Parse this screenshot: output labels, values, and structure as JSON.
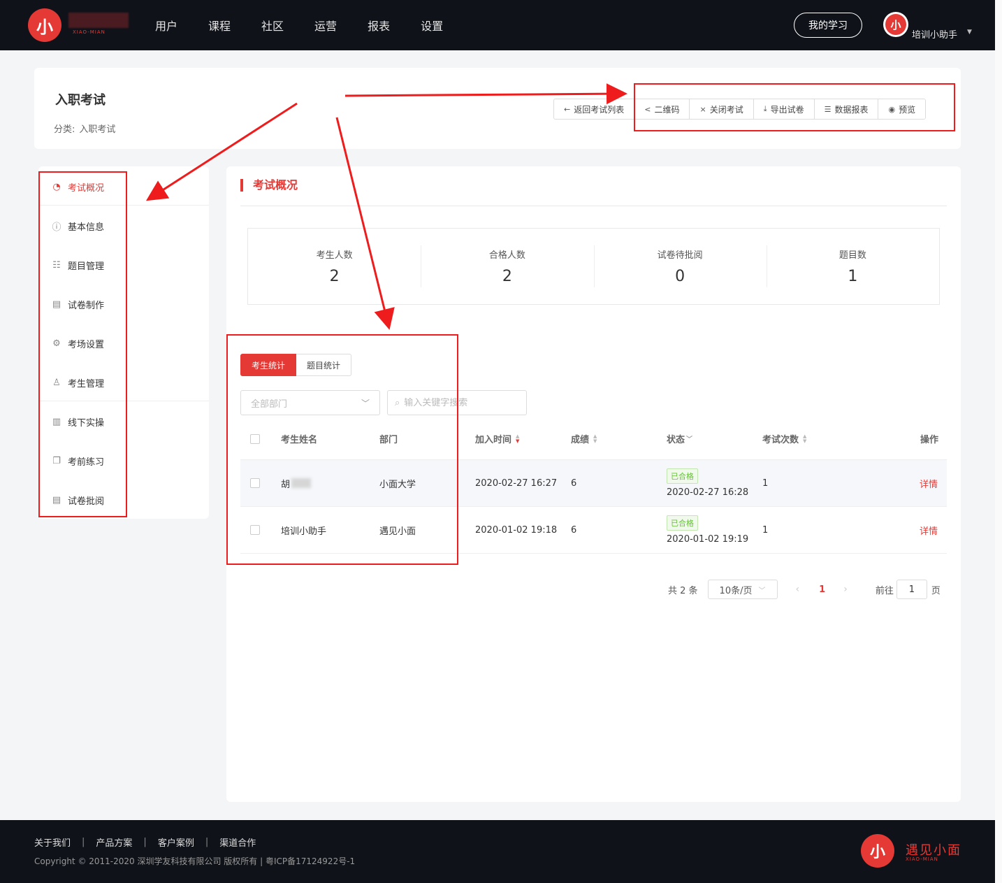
{
  "topbar": {
    "logo_char": "小",
    "logo_sub": "XIAO-MIAN",
    "nav": [
      "用户",
      "课程",
      "社区",
      "运营",
      "报表",
      "设置"
    ],
    "my_study": "我的学习",
    "avatar_char": "小",
    "user_name": "培训小助手"
  },
  "header": {
    "title": "入职考试",
    "category_label": "分类:",
    "category_value": "入职考试",
    "actions": [
      {
        "label": "返回考试列表",
        "icon": "arrow-left-icon",
        "glyph": "←"
      },
      {
        "label": "二维码",
        "icon": "share-icon",
        "glyph": "<"
      },
      {
        "label": "关闭考试",
        "icon": "close-icon",
        "glyph": "×"
      },
      {
        "label": "导出试卷",
        "icon": "download-icon",
        "glyph": "⤓"
      },
      {
        "label": "数据报表",
        "icon": "report-icon",
        "glyph": "☰"
      },
      {
        "label": "预览",
        "icon": "eye-icon",
        "glyph": "◉"
      }
    ]
  },
  "sidebar": {
    "items": [
      {
        "label": "考试概况",
        "icon": "pie-chart-icon",
        "glyph": "◔",
        "active": true
      },
      {
        "label": "基本信息",
        "icon": "info-icon",
        "glyph": "ⓘ"
      },
      {
        "label": "题目管理",
        "icon": "list-icon",
        "glyph": "☷"
      },
      {
        "label": "试卷制作",
        "icon": "paper-edit-icon",
        "glyph": "▤"
      },
      {
        "label": "考场设置",
        "icon": "gear-icon",
        "glyph": "⚙"
      },
      {
        "label": "考生管理",
        "icon": "user-icon",
        "glyph": "♙"
      },
      {
        "label": "线下实操",
        "icon": "sliders-icon",
        "glyph": "▥"
      },
      {
        "label": "考前练习",
        "icon": "copy-icon",
        "glyph": "❐"
      },
      {
        "label": "试卷批阅",
        "icon": "review-icon",
        "glyph": "▤"
      }
    ]
  },
  "main": {
    "section_title": "考试概况",
    "stats": [
      {
        "label": "考生人数",
        "value": "2"
      },
      {
        "label": "合格人数",
        "value": "2"
      },
      {
        "label": "试卷待批阅",
        "value": "0"
      },
      {
        "label": "题目数",
        "value": "1"
      }
    ],
    "tabs": [
      "考生统计",
      "题目统计"
    ],
    "dept_select": "全部部门",
    "search_placeholder": "输入关键字搜索",
    "table": {
      "headers": [
        "考生姓名",
        "部门",
        "加入时间",
        "成绩",
        "状态",
        "考试次数",
        "操作"
      ],
      "rows": [
        {
          "name": "胡",
          "dept": "小面大学",
          "join_time": "2020-02-27 16:27",
          "score": "6",
          "status": "已合格",
          "status_time": "2020-02-27 16:28",
          "attempts": "1",
          "action": "详情"
        },
        {
          "name": "培训小助手",
          "dept": "遇见小面",
          "join_time": "2020-01-02 19:18",
          "score": "6",
          "status": "已合格",
          "status_time": "2020-01-02 19:19",
          "attempts": "1",
          "action": "详情"
        }
      ]
    },
    "pagination": {
      "total": "共 2 条",
      "page_size": "10条/页",
      "current": "1",
      "goto_label": "前往",
      "goto_value": "1",
      "unit": "页"
    }
  },
  "footer": {
    "links": [
      "关于我们",
      "产品方案",
      "客户案例",
      "渠道合作"
    ],
    "copyright": "Copyright © 2011-2020 深圳学友科技有限公司 版权所有 | 粤ICP备17124922号-1",
    "brand": "遇见小面",
    "brand_sub": "XIAO-MIAN",
    "logo_char": "小"
  },
  "colors": {
    "accent": "#e53935",
    "topbar": "#0f1218",
    "annotation": "#ee1c1c",
    "pass": "#67c23a"
  }
}
